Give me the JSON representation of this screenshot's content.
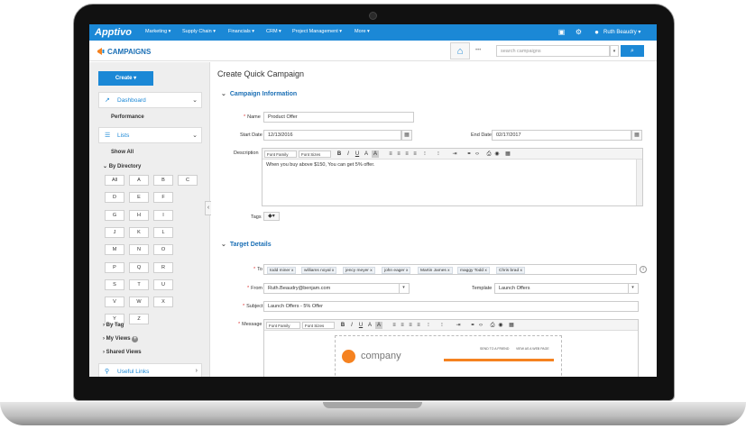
{
  "app": {
    "logo": "Apptivo",
    "nav": [
      "Marketing ▾",
      "Supply Chain ▾",
      "Financials ▾",
      "CRM ▾",
      "Project Management ▾",
      "More ▾"
    ],
    "user": "Ruth Beaudry ▾",
    "module_title": "CAMPAIGNS",
    "search_placeholder": "search campaigns",
    "dots": "•••",
    "colors": {
      "brand": "#1b88d6",
      "accent": "#f58220"
    }
  },
  "sidebar": {
    "create_label": "Create ▾",
    "dashboard_label": "Dashboard",
    "performance_label": "Performance",
    "lists_label": "Lists",
    "show_all": "Show All",
    "by_directory": "By Directory",
    "alphabet": [
      "All",
      "A",
      "B",
      "C",
      "D",
      "E",
      "F",
      "G",
      "H",
      "I",
      "J",
      "K",
      "L",
      "M",
      "N",
      "O",
      "P",
      "Q",
      "R",
      "S",
      "T",
      "U",
      "V",
      "W",
      "X",
      "Y",
      "Z"
    ],
    "by_tag": "By Tag",
    "my_views": "My Views",
    "shared_views": "Shared Views",
    "useful_links": "Useful Links"
  },
  "form": {
    "page_title": "Create Quick Campaign",
    "section_info": "Campaign Information",
    "name_label": "Name",
    "name_value": "Product Offer",
    "start_label": "Start Date",
    "start_value": "12/13/2016",
    "end_label": "End Date",
    "end_value": "02/17/2017",
    "desc_label": "Description",
    "desc_value": "When you buy above $150, You can get 5% offer.",
    "font_family": "Font Family",
    "font_sizes": "Font Sizes",
    "tags_label": "Tags",
    "section_target": "Target Details",
    "to_label": "To",
    "recipients": [
      "todd miner  x",
      "williams noyal  x",
      "jency meyer  x",
      "john eager  x",
      "Martin James  x",
      "maggy Todd  x",
      "Chris brad  x"
    ],
    "from_label": "From",
    "from_value": "Ruth.Beaudry@benjam.com",
    "template_label": "Template",
    "template_value": "Launch Offers",
    "subject_label": "Subject",
    "subject_value": "Launch Offers - 5% Offer",
    "message_label": "Message",
    "preview": {
      "company": "company",
      "link1": "SEND TO A FRIEND",
      "link2": "VIEW AS A WEB PAGE"
    }
  }
}
